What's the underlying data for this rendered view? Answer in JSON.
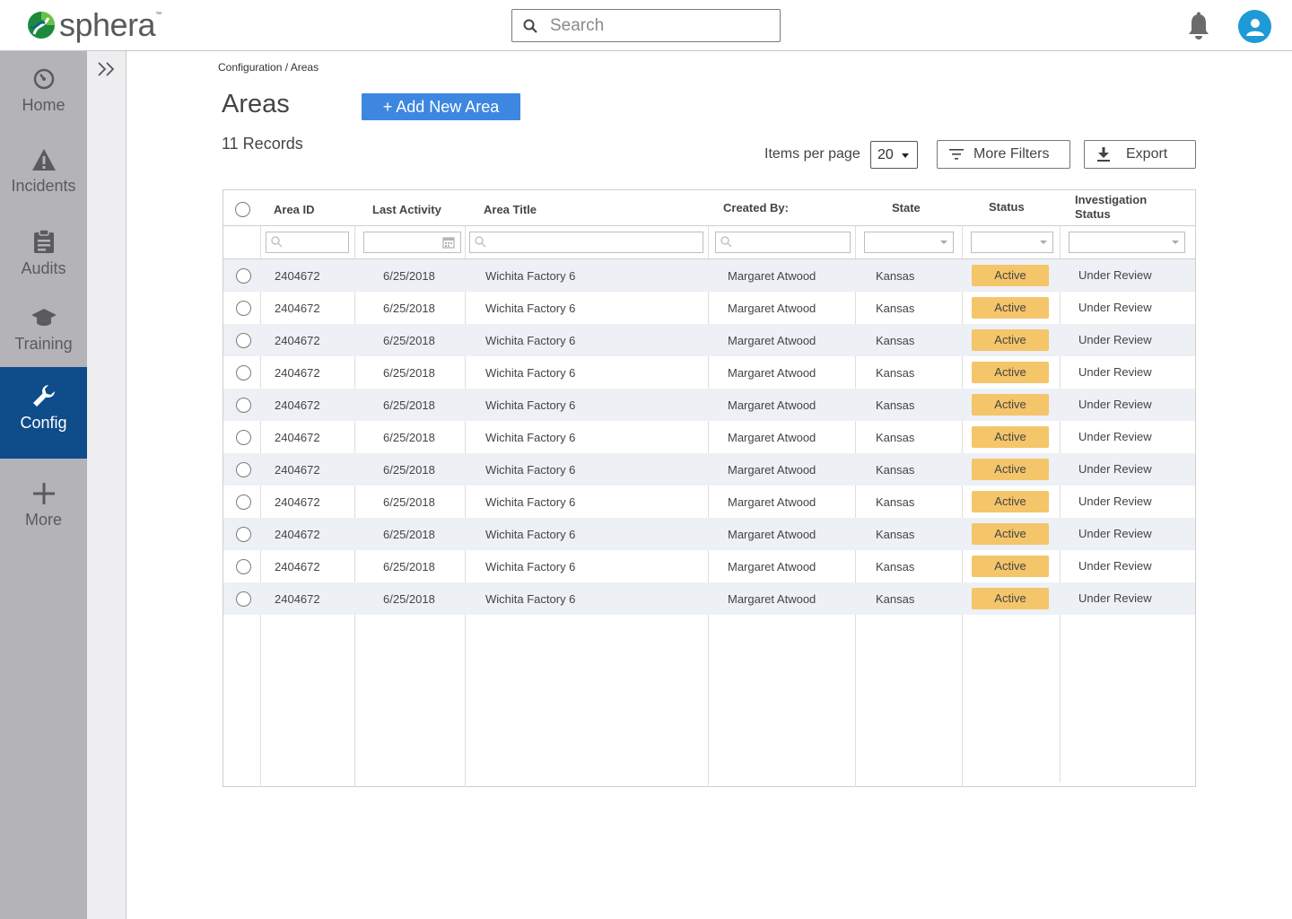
{
  "app": {
    "logo_text": "sphera",
    "logo_tm": "™",
    "search_placeholder": "Search"
  },
  "nav": {
    "items": [
      {
        "label": "Home",
        "icon": "dashboard-icon"
      },
      {
        "label": "Incidents",
        "icon": "warning-icon"
      },
      {
        "label": "Audits",
        "icon": "clipboard-icon"
      },
      {
        "label": "Training",
        "icon": "graduation-cap-icon"
      },
      {
        "label": "Config",
        "icon": "wrench-icon",
        "active": true
      },
      {
        "label": "More",
        "icon": "plus-icon"
      }
    ]
  },
  "page": {
    "breadcrumb": "Configuration / Areas",
    "title": "Areas",
    "add_button": "+ Add New Area",
    "records": "11 Records",
    "items_per_page_label": "Items per page",
    "items_per_page_value": "20",
    "more_filters": "More Filters",
    "export": "Export"
  },
  "table": {
    "headers": {
      "area_id": "Area ID",
      "last_activity": "Last Activity",
      "area_title": "Area Title",
      "created_by": "Created By:",
      "state": "State",
      "status": "Status",
      "investigation_status_1": "Investigation",
      "investigation_status_2": "Status"
    },
    "rows": [
      {
        "area_id": "2404672",
        "last_activity": "6/25/2018",
        "area_title": "Wichita Factory 6",
        "created_by": "Margaret Atwood",
        "state": "Kansas",
        "status": "Active",
        "investigation_status": "Under Review"
      },
      {
        "area_id": "2404672",
        "last_activity": "6/25/2018",
        "area_title": "Wichita Factory 6",
        "created_by": "Margaret Atwood",
        "state": "Kansas",
        "status": "Active",
        "investigation_status": "Under Review"
      },
      {
        "area_id": "2404672",
        "last_activity": "6/25/2018",
        "area_title": "Wichita Factory 6",
        "created_by": "Margaret Atwood",
        "state": "Kansas",
        "status": "Active",
        "investigation_status": "Under Review"
      },
      {
        "area_id": "2404672",
        "last_activity": "6/25/2018",
        "area_title": "Wichita Factory 6",
        "created_by": "Margaret Atwood",
        "state": "Kansas",
        "status": "Active",
        "investigation_status": "Under Review"
      },
      {
        "area_id": "2404672",
        "last_activity": "6/25/2018",
        "area_title": "Wichita Factory 6",
        "created_by": "Margaret Atwood",
        "state": "Kansas",
        "status": "Active",
        "investigation_status": "Under Review"
      },
      {
        "area_id": "2404672",
        "last_activity": "6/25/2018",
        "area_title": "Wichita Factory 6",
        "created_by": "Margaret Atwood",
        "state": "Kansas",
        "status": "Active",
        "investigation_status": "Under Review"
      },
      {
        "area_id": "2404672",
        "last_activity": "6/25/2018",
        "area_title": "Wichita Factory 6",
        "created_by": "Margaret Atwood",
        "state": "Kansas",
        "status": "Active",
        "investigation_status": "Under Review"
      },
      {
        "area_id": "2404672",
        "last_activity": "6/25/2018",
        "area_title": "Wichita Factory 6",
        "created_by": "Margaret Atwood",
        "state": "Kansas",
        "status": "Active",
        "investigation_status": "Under Review"
      },
      {
        "area_id": "2404672",
        "last_activity": "6/25/2018",
        "area_title": "Wichita Factory 6",
        "created_by": "Margaret Atwood",
        "state": "Kansas",
        "status": "Active",
        "investigation_status": "Under Review"
      },
      {
        "area_id": "2404672",
        "last_activity": "6/25/2018",
        "area_title": "Wichita Factory 6",
        "created_by": "Margaret Atwood",
        "state": "Kansas",
        "status": "Active",
        "investigation_status": "Under Review"
      },
      {
        "area_id": "2404672",
        "last_activity": "6/25/2018",
        "area_title": "Wichita Factory 6",
        "created_by": "Margaret Atwood",
        "state": "Kansas",
        "status": "Active",
        "investigation_status": "Under Review"
      }
    ]
  },
  "colors": {
    "accent_blue": "#3d87e0",
    "nav_active": "#0e4c8a",
    "nav_bg": "#b3b3b8",
    "status_active": "#f5c56a",
    "avatar": "#1e9ad6"
  }
}
